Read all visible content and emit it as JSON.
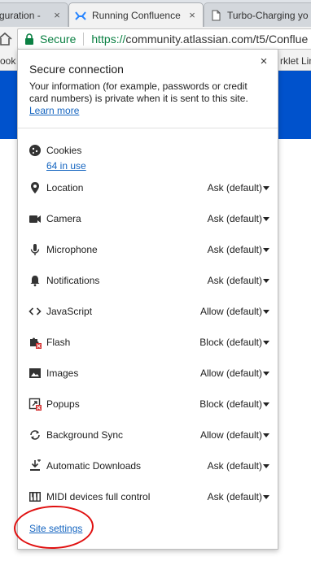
{
  "tabs": [
    {
      "title": "guration -",
      "active": false
    },
    {
      "title": "Running Confluence",
      "active": true
    },
    {
      "title": "Turbo-Charging yo",
      "active": false
    }
  ],
  "tab_close_glyph": "×",
  "omnibox": {
    "secure_label": "Secure",
    "url_scheme": "https://",
    "url_rest": "community.atlassian.com/t5/Conflue"
  },
  "bookmarks": {
    "left_text": "ook",
    "right_text": "rklet Lin"
  },
  "colors": {
    "banner": "#0052cc",
    "secure_green": "#0b8043",
    "link_blue": "#1565c0",
    "annotation_red": "#e01010"
  },
  "popup": {
    "title": "Secure connection",
    "close_glyph": "×",
    "description": "Your information (for example, passwords or credit card numbers) is private when it is sent to this site.",
    "learn_more": "Learn more",
    "cookies": {
      "label": "Cookies",
      "usage": "64 in use",
      "icon": "cookie-icon"
    },
    "permissions": [
      {
        "label": "Location",
        "value": "Ask (default)",
        "icon": "location-pin-icon"
      },
      {
        "label": "Camera",
        "value": "Ask (default)",
        "icon": "camera-icon"
      },
      {
        "label": "Microphone",
        "value": "Ask (default)",
        "icon": "microphone-icon"
      },
      {
        "label": "Notifications",
        "value": "Ask (default)",
        "icon": "bell-icon"
      },
      {
        "label": "JavaScript",
        "value": "Allow (default)",
        "icon": "code-brackets-icon"
      },
      {
        "label": "Flash",
        "value": "Block (default)",
        "icon": "puzzle-blocked-icon"
      },
      {
        "label": "Images",
        "value": "Allow (default)",
        "icon": "image-icon"
      },
      {
        "label": "Popups",
        "value": "Block (default)",
        "icon": "popup-blocked-icon"
      },
      {
        "label": "Background Sync",
        "value": "Allow (default)",
        "icon": "sync-icon"
      },
      {
        "label": "Automatic Downloads",
        "value": "Ask (default)",
        "icon": "download-icon"
      },
      {
        "label": "MIDI devices full control",
        "value": "Ask (default)",
        "icon": "piano-icon"
      }
    ],
    "site_settings": "Site settings"
  }
}
